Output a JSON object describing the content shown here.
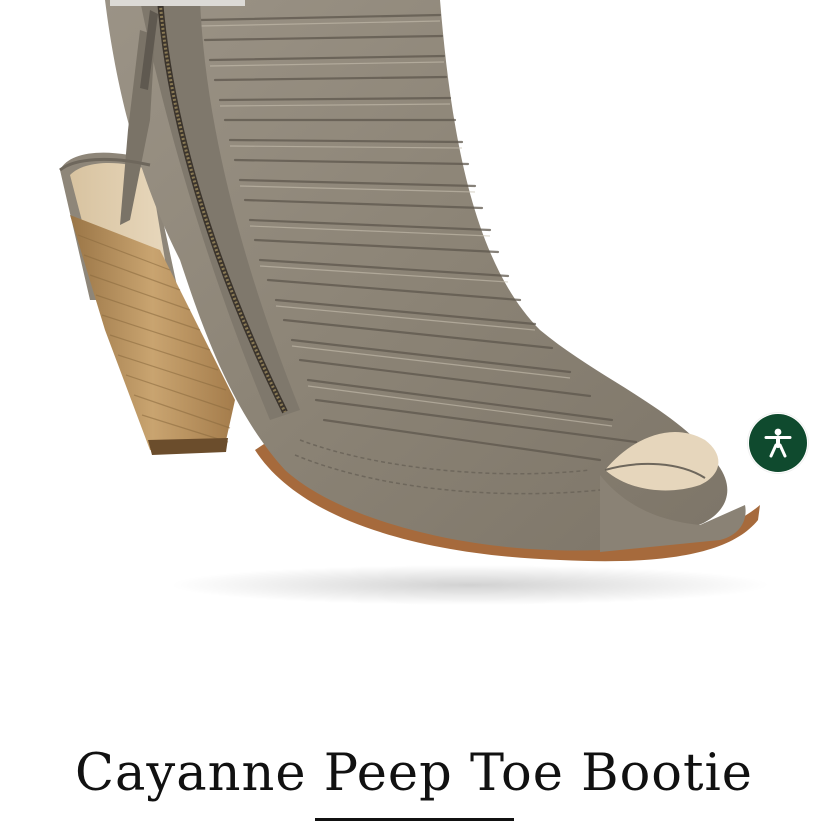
{
  "product": {
    "title": "Cayanne Peep Toe Bootie",
    "image_alt": "Taupe distressed suede peep-toe bootie with stacked wood heel and side zip"
  },
  "accessibility": {
    "icon": "accessibility-person-icon",
    "color": "#0f4a2e",
    "label": "Accessibility"
  },
  "colors": {
    "suede": "#8f877a",
    "suede_dark": "#6e675c",
    "heel_wood": "#b8935f",
    "sole_edge": "#a66a3c",
    "title_text": "#111111"
  }
}
